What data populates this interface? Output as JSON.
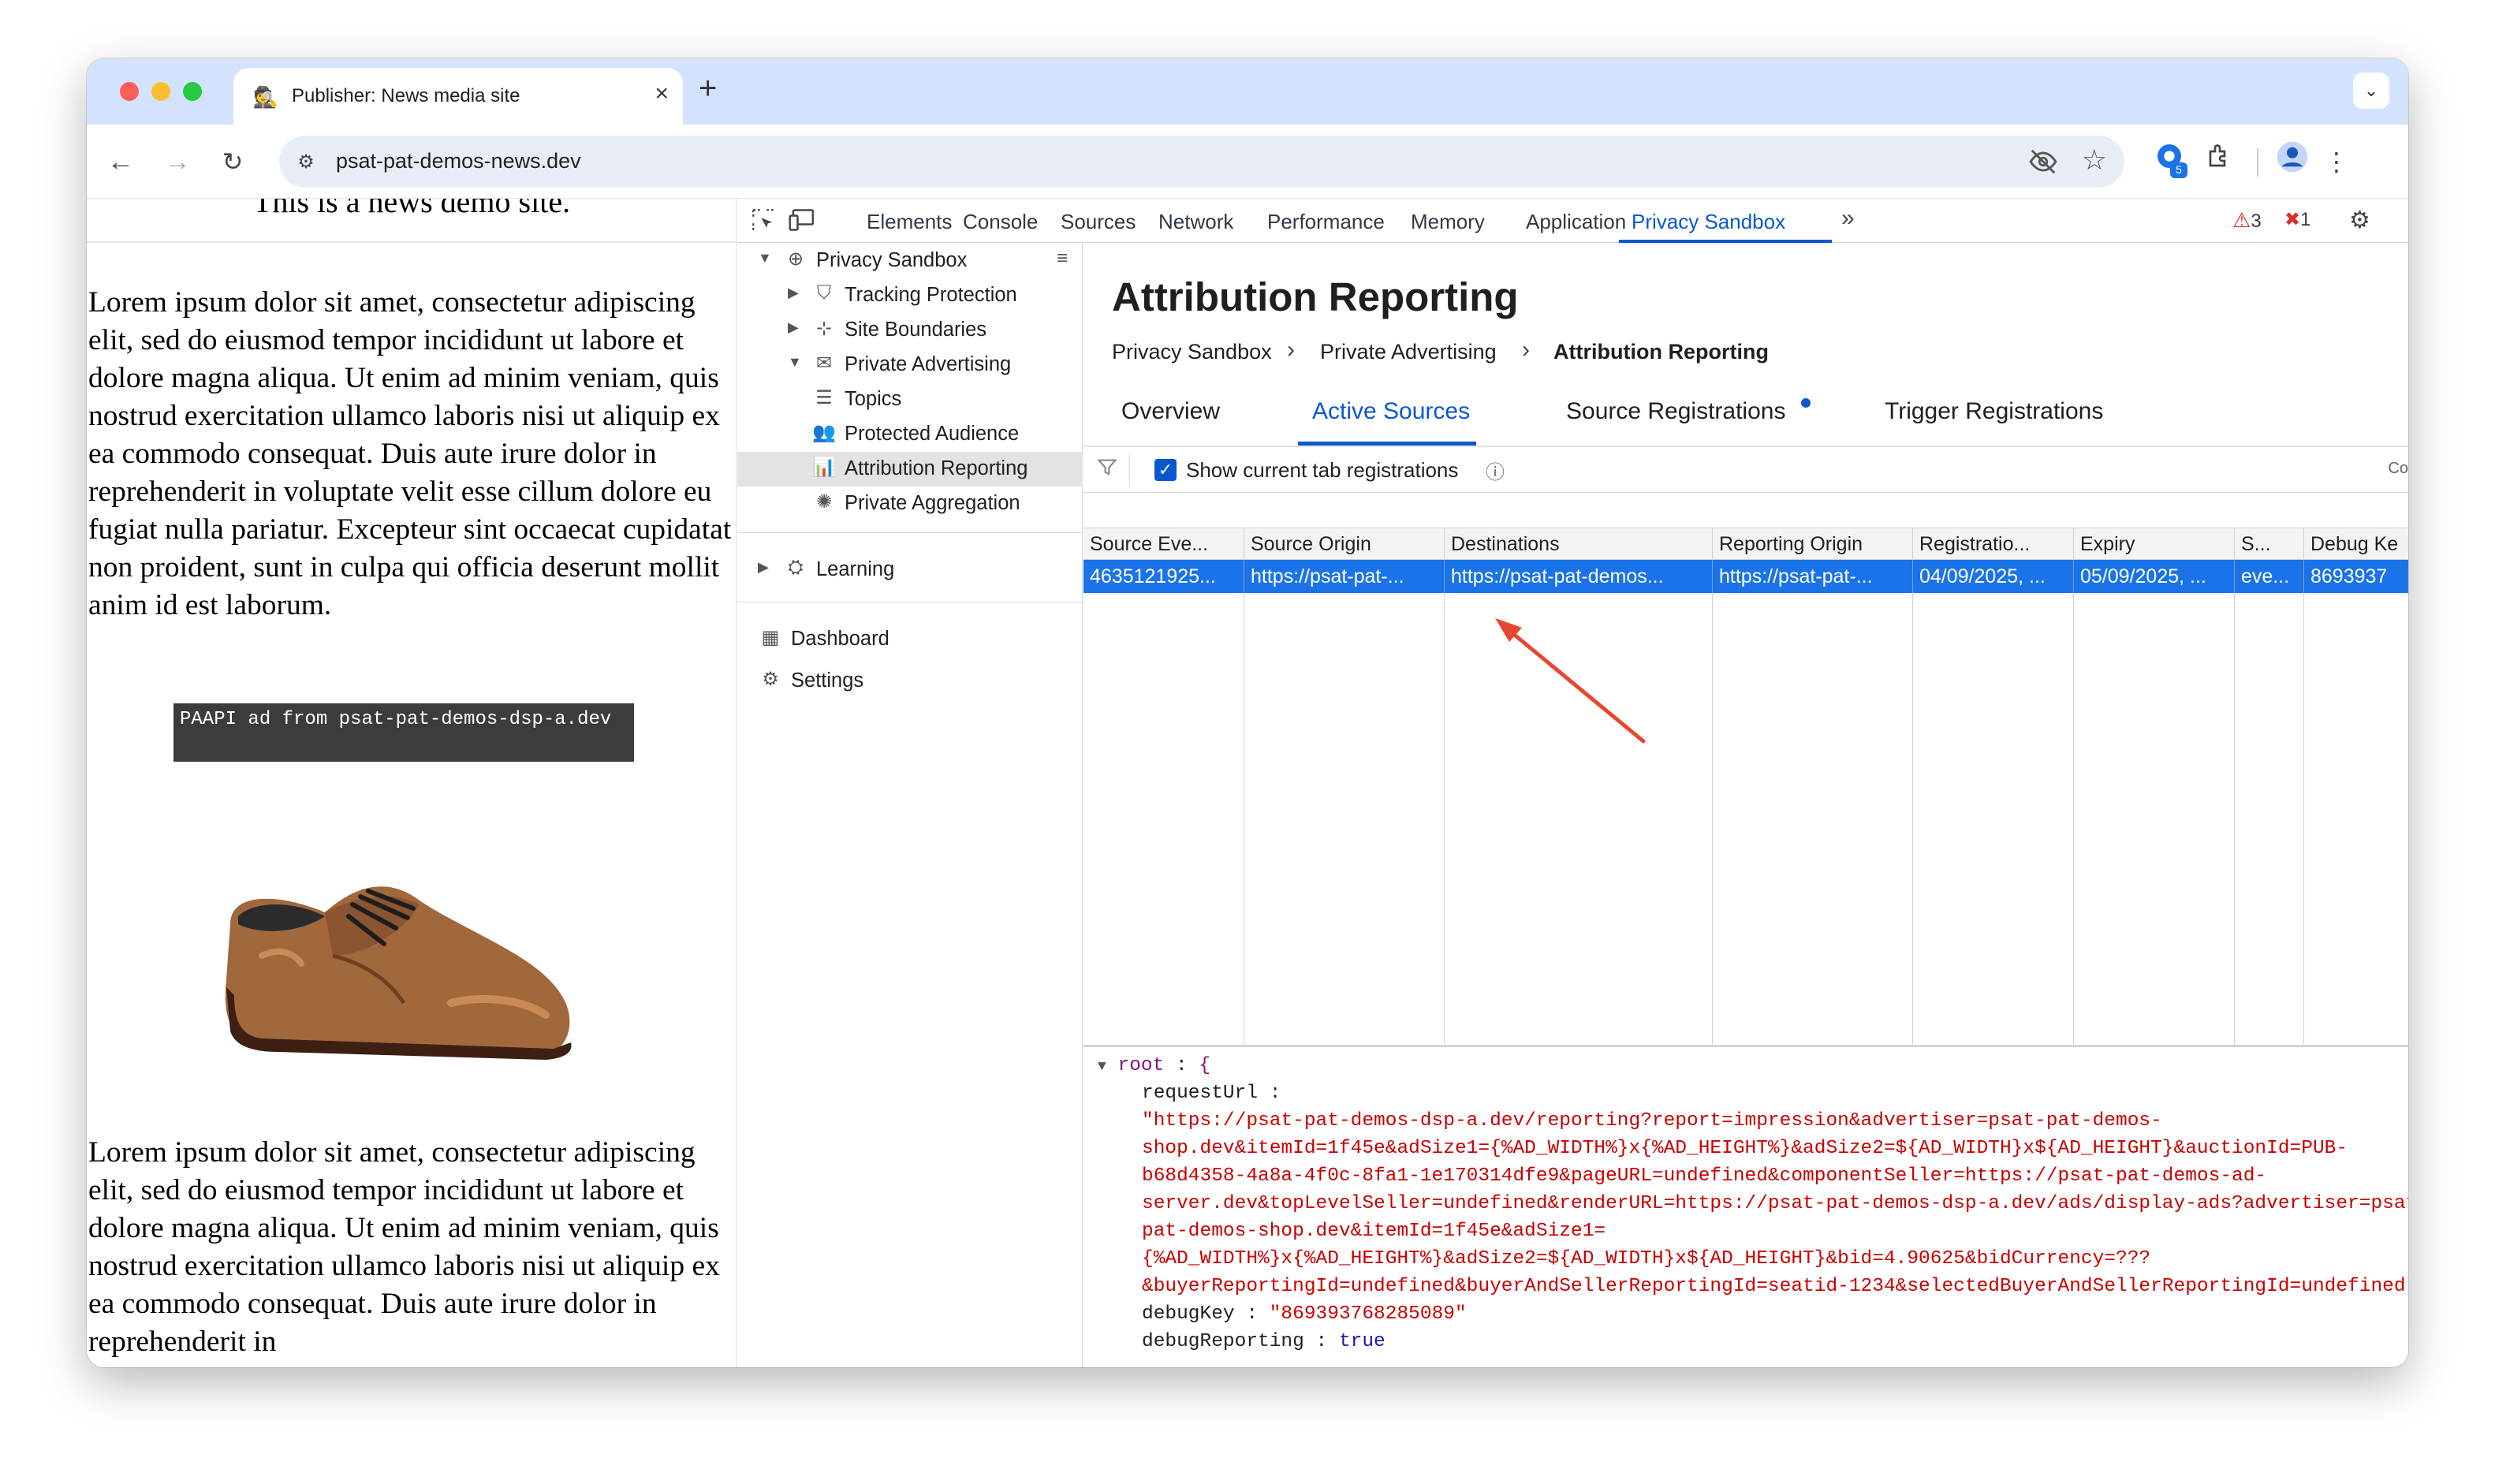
{
  "browser": {
    "tab_title": "Publisher: News media site",
    "tab_favicon": "🕵",
    "url": "psat-pat-demos-news.dev",
    "extension_badge": "5"
  },
  "page": {
    "cut_heading": "This is a news demo site.",
    "paragraph_1": "Lorem ipsum dolor sit amet, consectetur adipiscing elit, sed do eiusmod tempor incididunt ut labore et dolore magna aliqua. Ut enim ad minim veniam, quis nostrud exercitation ullamco laboris nisi ut aliquip ex ea commodo consequat. Duis aute irure dolor in reprehenderit in voluptate velit esse cillum dolore eu fugiat nulla pariatur. Excepteur sint occaecat cupidatat non proident, sunt in culpa qui officia deserunt mollit anim id est laborum.",
    "ad_label": "PAAPI ad from psat-pat-demos-dsp-a.dev",
    "paragraph_2": "Lorem ipsum dolor sit amet, consectetur adipiscing elit, sed do eiusmod tempor incididunt ut labore et dolore magna aliqua. Ut enim ad minim veniam, quis nostrud exercitation ullamco laboris nisi ut aliquip ex ea commodo consequat. Duis aute irure dolor in reprehenderit in"
  },
  "devtools": {
    "tabs": [
      "Elements",
      "Console",
      "Sources",
      "Network",
      "Performance",
      "Memory",
      "Application",
      "Privacy Sandbox"
    ],
    "active_tab": "Privacy Sandbox",
    "warnings_count": "3",
    "errors_count": "1",
    "sidebar": {
      "root": "Privacy Sandbox",
      "tracking_protection": "Tracking Protection",
      "site_boundaries": "Site Boundaries",
      "private_advertising": "Private Advertising",
      "topics": "Topics",
      "protected_audience": "Protected Audience",
      "attribution_reporting": "Attribution Reporting",
      "private_aggregation": "Private Aggregation",
      "learning": "Learning",
      "dashboard": "Dashboard",
      "settings": "Settings"
    },
    "panel": {
      "title": "Attribution Reporting",
      "breadcrumb": [
        "Privacy Sandbox",
        "Private Advertising",
        "Attribution Reporting"
      ],
      "tabs": [
        "Overview",
        "Active Sources",
        "Source Registrations",
        "Trigger Registrations"
      ],
      "active_tab": "Active Sources",
      "checkbox_label": "Show current tab registrations",
      "right_cut": "Co",
      "columns": [
        "Source Eve...",
        "Source Origin",
        "Destinations",
        "Reporting Origin",
        "Registratio...",
        "Expiry",
        "S...",
        "Debug Ke"
      ],
      "row": [
        "4635121925...",
        "https://psat-pat-...",
        "https://psat-pat-demos...",
        "https://psat-pat-...",
        "04/09/2025, ...",
        "05/09/2025, ...",
        "eve...",
        "8693937"
      ],
      "json": {
        "root_label": "root",
        "root_open": "{",
        "request_url_key": "requestUrl",
        "request_url_lines": [
          "\"https://psat-pat-demos-dsp-a.dev/reporting?report=impression&advertiser=psat-pat-demos-",
          "shop.dev&itemId=1f45e&adSize1={%AD_WIDTH%}x{%AD_HEIGHT%}&adSize2=${AD_WIDTH}x${AD_HEIGHT}&auctionId=PUB-",
          "b68d4358-4a8a-4f0c-8fa1-1e170314dfe9&pageURL=undefined&componentSeller=https://psat-pat-demos-ad-",
          "server.dev&topLevelSeller=undefined&renderURL=https://psat-pat-demos-dsp-a.dev/ads/display-ads?advertiser=psat-",
          "pat-demos-shop.dev&itemId=1f45e&adSize1=",
          "{%AD_WIDTH%}x{%AD_HEIGHT%}&adSize2=${AD_WIDTH}x${AD_HEIGHT}&bid=4.90625&bidCurrency=???",
          "&buyerReportingId=undefined&buyerAndSellerReportingId=seatid-1234&selectedBuyerAndSellerReportingId=undefined\""
        ],
        "debug_key_key": "debugKey",
        "debug_key_value": "\"869393768285089\"",
        "debug_reporting_key": "debugReporting",
        "debug_reporting_value": "true"
      }
    }
  },
  "colors": {
    "accent": "#0b57d0",
    "selected_row": "#1a73e8",
    "tab_strip": "#d3e3fd",
    "annotation_arrow": "#e8472f"
  }
}
